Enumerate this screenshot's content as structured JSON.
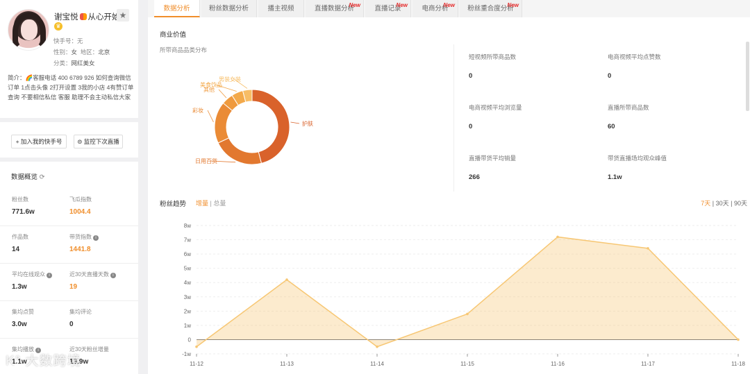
{
  "profile": {
    "name": "谢宝悦",
    "name_suffix": "从心开始",
    "kuaishou_id": "快手号：无",
    "gender_label": "性别：",
    "gender": "女",
    "region_label": "地区：",
    "region": "北京",
    "category_label": "分类：",
    "category": "网红美女",
    "bio": "简介：🌈客服电话 400 6789 926 如何查询微信订单 1点击头像 2打开设置 3我的小店 4有赞订单查询 不要相信私信 客服 助理不会主动私信大家"
  },
  "buttons": {
    "add_kuaishou": "+ 加入我的快手号",
    "monitor_live": "监控下次直播"
  },
  "overview": {
    "title": "数据概览",
    "stats": [
      {
        "label": "粉丝数",
        "value": "771.6w",
        "orange": false
      },
      {
        "label": "飞瓜指数",
        "value": "1004.4",
        "orange": true
      },
      {
        "label": "作品数",
        "value": "14",
        "orange": false
      },
      {
        "label": "带货指数",
        "value": "1441.8",
        "orange": true
      },
      {
        "label": "平均在线观众",
        "value": "1.3w",
        "orange": false
      },
      {
        "label": "近30天直播天数",
        "value": "19",
        "orange": true
      },
      {
        "label": "集均点赞",
        "value": "3.0w",
        "orange": false
      },
      {
        "label": "集均评论",
        "value": "0",
        "orange": false
      },
      {
        "label": "集均播放",
        "value": "1.1w",
        "orange": false
      },
      {
        "label": "近30天粉丝增量",
        "value": "13.9w",
        "orange": false
      }
    ]
  },
  "tabs": [
    {
      "label": "数据分析",
      "active": true,
      "new": false
    },
    {
      "label": "粉丝数据分析",
      "active": false,
      "new": false
    },
    {
      "label": "播主视频",
      "active": false,
      "new": false
    },
    {
      "label": "直播数据分析",
      "active": false,
      "new": true
    },
    {
      "label": "直播记录",
      "active": false,
      "new": true
    },
    {
      "label": "电商分析",
      "active": false,
      "new": true
    },
    {
      "label": "粉丝重合度分析",
      "active": false,
      "new": true
    }
  ],
  "new_tag": "New",
  "commerce": {
    "title": "商业价值",
    "donut_title": "所带商品品类分布",
    "kvs": [
      {
        "label": "短视频所带商品数",
        "value": "0"
      },
      {
        "label": "电商视频平均点赞数",
        "value": "0"
      },
      {
        "label": "电商视频平均浏览量",
        "value": "0"
      },
      {
        "label": "直播所带商品数",
        "value": "60"
      },
      {
        "label": "直播带货平均销量",
        "value": "266"
      },
      {
        "label": "带货直播场均观众峰值",
        "value": "1.1w"
      }
    ]
  },
  "chart_data": [
    {
      "type": "pie",
      "title": "所带商品品类分布",
      "categories": [
        "护肤",
        "日用百货",
        "彩妆",
        "其他",
        "美食饮品",
        "男装女装"
      ],
      "values": [
        46,
        22,
        18,
        5,
        5,
        4
      ],
      "colors": [
        "#d9622b",
        "#e2782f",
        "#ea8b36",
        "#ef9a3e",
        "#f3a94a",
        "#f7bd66"
      ]
    },
    {
      "type": "area",
      "title": "粉丝趋势",
      "x": [
        "11-12",
        "11-13",
        "11-14",
        "11-15",
        "11-16",
        "11-17",
        "11-18"
      ],
      "series": [
        {
          "name": "增量",
          "values": [
            -0.5,
            4.2,
            -0.5,
            1.8,
            7.2,
            6.4,
            0
          ]
        }
      ],
      "yticks": [
        "-1w",
        "0",
        "1w",
        "2w",
        "3w",
        "4w",
        "5w",
        "6w",
        "7w",
        "8w"
      ],
      "ylim": [
        -1,
        8
      ],
      "grid": true,
      "color": "#f7c774"
    }
  ],
  "trend": {
    "title": "粉丝趋势",
    "toggle_on": "增量",
    "toggle_sep": " | ",
    "toggle_off": "总量",
    "range_7": "7天",
    "range_30": "30天",
    "range_90": "90天",
    "range_sep": " | "
  },
  "watermark": "大数跨境",
  "watermark_logo": "K°"
}
